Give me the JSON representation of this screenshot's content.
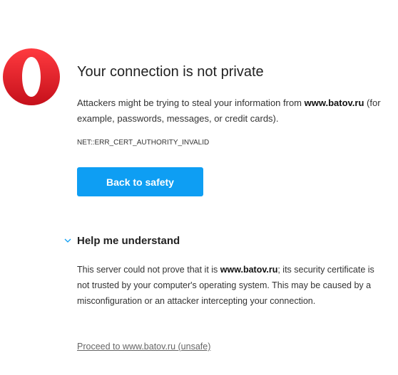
{
  "logo": {
    "icon": "opera-logo-icon",
    "color": "#e0161f"
  },
  "heading": "Your connection is not private",
  "description": {
    "before": "Attackers might be trying to steal your information from ",
    "domain": "www.batov.ru",
    "after": " (for example, passwords, messages, or credit cards)."
  },
  "error_code": "NET::ERR_CERT_AUTHORITY_INVALID",
  "back_button": {
    "label": "Back to safety",
    "color": "#0e9ef3"
  },
  "help": {
    "icon": "chevron-down-icon",
    "heading": "Help me understand",
    "text_before": "This server could not prove that it is ",
    "domain": "www.batov.ru",
    "text_after": "; its security certificate is not trusted by your computer's operating system. This may be caused by a misconfiguration or an attacker intercepting your connection."
  },
  "proceed_link": "Proceed to www.batov.ru (unsafe)"
}
